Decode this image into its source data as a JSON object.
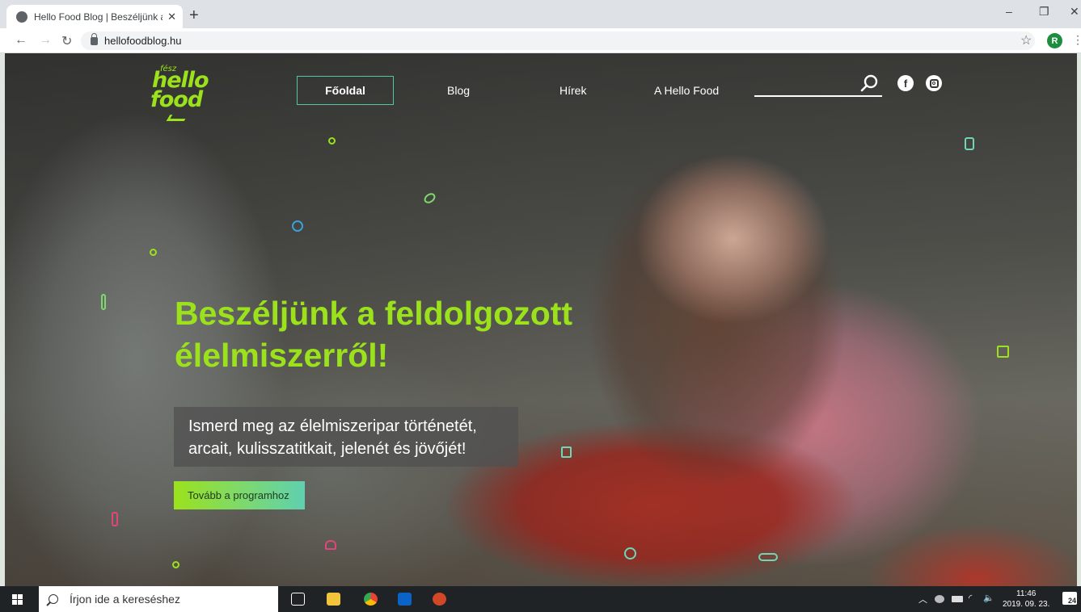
{
  "browser": {
    "tab_title": "Hello Food Blog | Beszéljünk a fe",
    "tab_close": "✕",
    "new_tab": "+",
    "url": "hellofoodblog.hu",
    "profile_initial": "R",
    "window_controls": {
      "minimize": "–",
      "restore": "❐",
      "close": "✕"
    }
  },
  "site": {
    "logo": {
      "fesz": "fész",
      "hello": "hello",
      "food": "food"
    },
    "nav": [
      {
        "label": "Főoldal",
        "active": true
      },
      {
        "label": "Blog"
      },
      {
        "label": "Hírek"
      },
      {
        "label": "A Hello Food"
      }
    ],
    "social": [
      "facebook-icon",
      "instagram-icon"
    ],
    "hero": {
      "headline_line1": "Beszéljünk a feldolgozott",
      "headline_line2": "élelmiszerről!",
      "sub_line1": "Ismerd meg az élelmiszeripar történetét,",
      "sub_line2": "arcait, kulisszatitkait, jelenét és jövőjét!",
      "cta": "Tovább a programhoz"
    },
    "colors": {
      "accent_green": "#9be21c",
      "accent_teal": "#53c7a4"
    }
  },
  "taskbar": {
    "search_placeholder": "Írjon ide a kereséshez",
    "time": "11:46",
    "date": "2019. 09. 23.",
    "notifications": "24"
  }
}
